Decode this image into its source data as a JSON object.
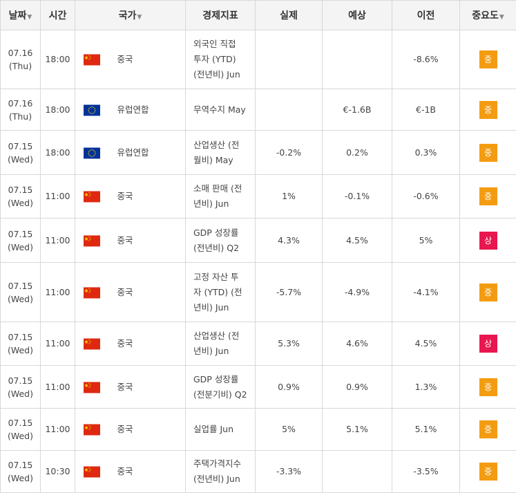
{
  "colors": {
    "medium": "#f39c12",
    "high": "#e8174f",
    "cn_red": "#de2910",
    "cn_star": "#ffde00",
    "eu_blue": "#003399",
    "eu_star": "#ffcc00"
  },
  "header": {
    "date": "날짜",
    "time": "시간",
    "country": "국가",
    "indicator": "경제지표",
    "actual": "실제",
    "forecast": "예상",
    "previous": "이전",
    "importance": "중요도",
    "sort_arrow": "▼"
  },
  "rows": [
    {
      "date": "07.16",
      "day": "(Thu)",
      "time": "18:00",
      "flag": "cn-flag-icon",
      "country": "중국",
      "indicator_lines": [
        "외국인 직접",
        "투자 (YTD)",
        "(전년비) Jun"
      ],
      "actual": "",
      "forecast": "",
      "previous": "-8.6%",
      "importance": "중",
      "level": "medium"
    },
    {
      "date": "07.16",
      "day": "(Thu)",
      "time": "18:00",
      "flag": "eu-flag-icon",
      "country": "유럽연합",
      "indicator_lines": [
        "무역수지 May"
      ],
      "actual": "",
      "forecast": "€-1.6B",
      "previous": "€-1B",
      "importance": "중",
      "level": "medium"
    },
    {
      "date": "07.15",
      "day": "(Wed)",
      "time": "18:00",
      "flag": "eu-flag-icon",
      "country": "유럽연합",
      "indicator_lines": [
        "산업생산 (전",
        "월비) May"
      ],
      "actual": "-0.2%",
      "forecast": "0.2%",
      "previous": "0.3%",
      "importance": "중",
      "level": "medium"
    },
    {
      "date": "07.15",
      "day": "(Wed)",
      "time": "11:00",
      "flag": "cn-flag-icon",
      "country": "중국",
      "indicator_lines": [
        "소매 판매 (전",
        "년비) Jun"
      ],
      "actual": "1%",
      "forecast": "-0.1%",
      "previous": "-0.6%",
      "importance": "중",
      "level": "medium"
    },
    {
      "date": "07.15",
      "day": "(Wed)",
      "time": "11:00",
      "flag": "cn-flag-icon",
      "country": "중국",
      "indicator_lines": [
        "GDP 성장률",
        "(전년비) Q2"
      ],
      "actual": "4.3%",
      "forecast": "4.5%",
      "previous": "5%",
      "importance": "상",
      "level": "high"
    },
    {
      "date": "07.15",
      "day": "(Wed)",
      "time": "11:00",
      "flag": "cn-flag-icon",
      "country": "중국",
      "indicator_lines": [
        "고정 자산 투",
        "자 (YTD) (전",
        "년비) Jun"
      ],
      "actual": "-5.7%",
      "forecast": "-4.9%",
      "previous": "-4.1%",
      "importance": "중",
      "level": "medium"
    },
    {
      "date": "07.15",
      "day": "(Wed)",
      "time": "11:00",
      "flag": "cn-flag-icon",
      "country": "중국",
      "indicator_lines": [
        "산업생산 (전",
        "년비) Jun"
      ],
      "actual": "5.3%",
      "forecast": "4.6%",
      "previous": "4.5%",
      "importance": "상",
      "level": "high"
    },
    {
      "date": "07.15",
      "day": "(Wed)",
      "time": "11:00",
      "flag": "cn-flag-icon",
      "country": "중국",
      "indicator_lines": [
        "GDP 성장률",
        "(전분기비) Q2"
      ],
      "actual": "0.9%",
      "forecast": "0.9%",
      "previous": "1.3%",
      "importance": "중",
      "level": "medium"
    },
    {
      "date": "07.15",
      "day": "(Wed)",
      "time": "11:00",
      "flag": "cn-flag-icon",
      "country": "중국",
      "indicator_lines": [
        "실업률 Jun"
      ],
      "actual": "5%",
      "forecast": "5.1%",
      "previous": "5.1%",
      "importance": "중",
      "level": "medium"
    },
    {
      "date": "07.15",
      "day": "(Wed)",
      "time": "10:30",
      "flag": "cn-flag-icon",
      "country": "중국",
      "indicator_lines": [
        "주택가격지수",
        "(전년비) Jun"
      ],
      "actual": "-3.3%",
      "forecast": "",
      "previous": "-3.5%",
      "importance": "중",
      "level": "medium"
    }
  ]
}
